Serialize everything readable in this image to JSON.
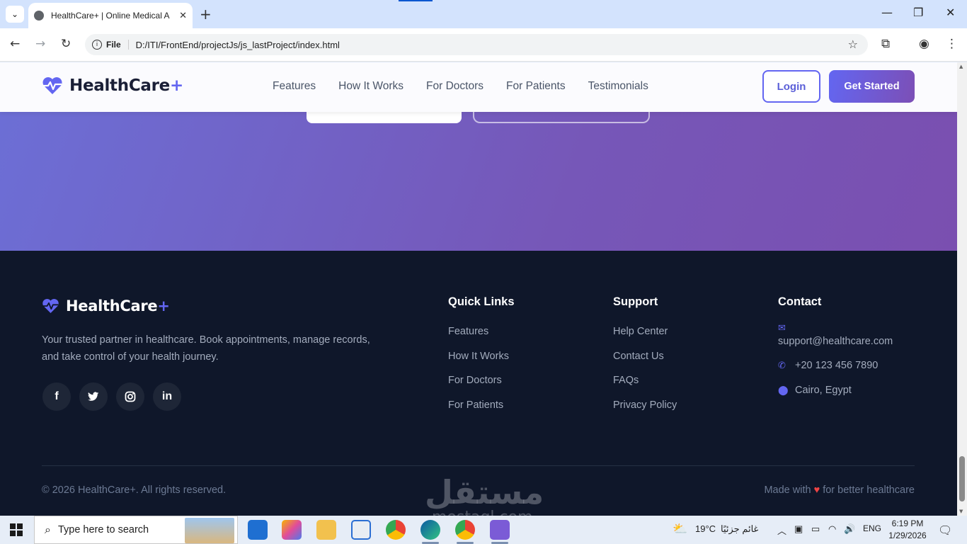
{
  "browser": {
    "tab_title": "HealthCare+ | Online Medical A",
    "tab_close": "✕",
    "new_tab": "+",
    "scheme_label": "File",
    "url": "D:/ITI/FrontEnd/projectJs/js_lastProject/index.html"
  },
  "site": {
    "brand": "HealthCare",
    "brand_plus": "+",
    "nav": [
      "Features",
      "How It Works",
      "For Doctors",
      "For Patients",
      "Testimonials"
    ],
    "login_label": "Login",
    "get_started_label": "Get Started"
  },
  "footer": {
    "brand": "HealthCare",
    "brand_plus": "+",
    "description": "Your trusted partner in healthcare. Book appointments, manage records, and take control of your health journey.",
    "socials": [
      {
        "icon": "facebook-icon",
        "glyph": "f"
      },
      {
        "icon": "twitter-icon",
        "glyph": "🐦"
      },
      {
        "icon": "instagram-icon",
        "glyph": "◎"
      },
      {
        "icon": "linkedin-icon",
        "glyph": "in"
      }
    ],
    "quick_links": {
      "title": "Quick Links",
      "items": [
        "Features",
        "How It Works",
        "For Doctors",
        "For Patients"
      ]
    },
    "support": {
      "title": "Support",
      "items": [
        "Help Center",
        "Contact Us",
        "FAQs",
        "Privacy Policy"
      ]
    },
    "contact": {
      "title": "Contact",
      "email": "support@healthcare.com",
      "phone": "+20 123 456 7890",
      "location": "Cairo, Egypt"
    },
    "copyright": "© 2026 HealthCare+. All rights reserved.",
    "made_with_prefix": "Made with",
    "made_with_suffix": "for better healthcare"
  },
  "watermark": {
    "arabic": "مستقل",
    "latin": "mostaql.com"
  },
  "taskbar": {
    "search_placeholder": "Type here to search",
    "weather_temp": "19°C",
    "weather_text": "غائم جزئيًا",
    "language": "ENG",
    "time": "6:19 PM",
    "date": "1/29/2026"
  },
  "colors": {
    "accent": "#6366f1",
    "hero_start": "#6c6fd6",
    "hero_end": "#7a4fb0",
    "footer_bg": "#0f172a"
  }
}
